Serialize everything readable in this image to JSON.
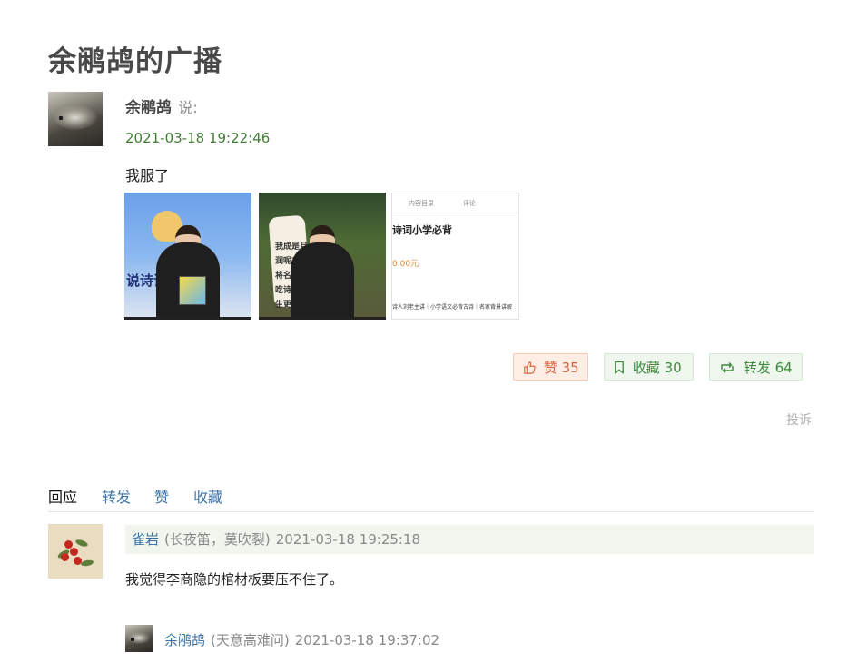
{
  "page": {
    "title": "余鹇鸪的广播"
  },
  "post": {
    "author": "余鹇鸪",
    "says": "说:",
    "time": "2021-03-18 19:22:46",
    "text": "我服了",
    "images": [
      {
        "alt": "lesson-video-1",
        "big_text": "说诗词"
      },
      {
        "alt": "lesson-video-2",
        "poem_lines": [
          "我成是月。",
          "润呢在啊。",
          "将名医抱。",
          "吃诗不留！",
          "生更何求！"
        ]
      },
      {
        "alt": "store-page",
        "tab1": "内容目录",
        "tab2": "评论",
        "title": "诗词小学必背",
        "price": "0.00元",
        "line": "诗人刘老主讲｜小学语文必背古诗｜名家背景讲解"
      }
    ]
  },
  "actions": {
    "like": {
      "label": "赞",
      "count": "35",
      "icon": "thumbs-up-icon"
    },
    "collect": {
      "label": "收藏",
      "count": "30",
      "icon": "bookmark-icon"
    },
    "share": {
      "label": "转发",
      "count": "64",
      "icon": "repost-icon"
    },
    "report": "投诉"
  },
  "tabs": [
    "回应",
    "转发",
    "赞",
    "收藏"
  ],
  "comments": [
    {
      "name": "雀岩",
      "signature": "(长夜笛，莫吹裂)",
      "time": "2021-03-18 19:25:18",
      "text": "我觉得李商隐的棺材板要压不住了。"
    }
  ],
  "reply": {
    "name": "余鹇鸪",
    "signature": "(天意高难问)",
    "time": "2021-03-18 19:37:02"
  },
  "colors": {
    "accent_green": "#3f7d32",
    "link_blue": "#3a72a8",
    "like_orange": "#d9663e"
  }
}
